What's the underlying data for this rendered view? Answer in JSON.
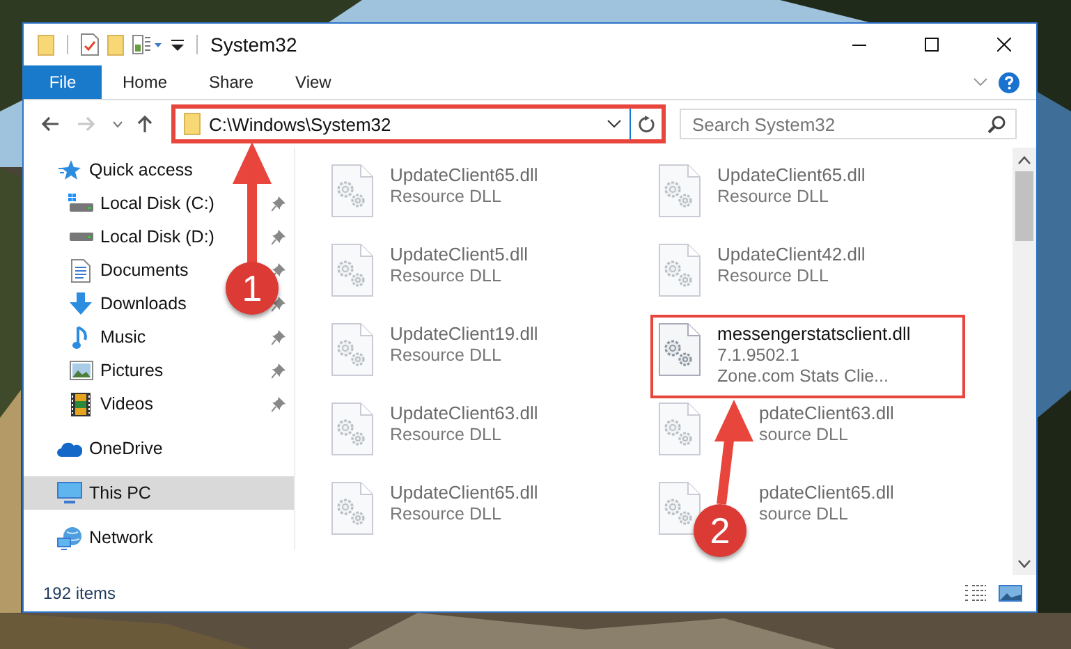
{
  "window": {
    "title": "System32"
  },
  "ribbon_tabs": [
    {
      "label": "File",
      "kind": "file"
    },
    {
      "label": "Home",
      "kind": "tab"
    },
    {
      "label": "Share",
      "kind": "tab"
    },
    {
      "label": "View",
      "kind": "tab"
    }
  ],
  "address_bar": {
    "path": "C:\\Windows\\System32",
    "highlighted": true
  },
  "search": {
    "placeholder": "Search System32"
  },
  "navigation": [
    {
      "label": "Quick access",
      "kind": "star",
      "selected": false,
      "children": [
        {
          "label": "Local Disk (C:)",
          "kind": "system-drive",
          "pinned": true,
          "selected": false
        },
        {
          "label": "Local Disk (D:)",
          "kind": "drive",
          "pinned": true,
          "selected": false
        },
        {
          "label": "Documents",
          "kind": "documents",
          "pinned": true,
          "selected": false
        },
        {
          "label": "Downloads",
          "kind": "downloads",
          "pinned": true,
          "selected": false
        },
        {
          "label": "Music",
          "kind": "music",
          "pinned": true,
          "selected": false
        },
        {
          "label": "Pictures",
          "kind": "pictures",
          "pinned": true,
          "selected": false
        },
        {
          "label": "Videos",
          "kind": "videos",
          "pinned": true,
          "selected": false
        }
      ]
    },
    {
      "label": "OneDrive",
      "kind": "cloud",
      "selected": false
    },
    {
      "label": "This PC",
      "kind": "pc",
      "selected": true
    },
    {
      "label": "Network",
      "kind": "network",
      "selected": false
    }
  ],
  "files": [
    {
      "name": "UpdateClient65.dll",
      "details": [
        "Resource DLL"
      ],
      "blurred": true,
      "highlighted": false,
      "partly_covered": false
    },
    {
      "name": "UpdateClient65.dll",
      "details": [
        "Resource DLL"
      ],
      "blurred": true,
      "highlighted": false,
      "partly_covered": false
    },
    {
      "name": "UpdateClient5.dll",
      "details": [
        "Resource DLL"
      ],
      "blurred": true,
      "highlighted": false,
      "partly_covered": false
    },
    {
      "name": "UpdateClient42.dll",
      "details": [
        "Resource DLL"
      ],
      "blurred": true,
      "highlighted": false,
      "partly_covered": false
    },
    {
      "name": "UpdateClient19.dll",
      "details": [
        "Resource DLL"
      ],
      "blurred": true,
      "highlighted": false,
      "partly_covered": false
    },
    {
      "name": "messengerstatsclient.dll",
      "details": [
        "7.1.9502.1",
        "Zone.com Stats Clie..."
      ],
      "blurred": false,
      "highlighted": true,
      "partly_covered": false
    },
    {
      "name": "UpdateClient63.dll",
      "details": [
        "Resource DLL"
      ],
      "blurred": true,
      "highlighted": false,
      "partly_covered": false
    },
    {
      "name": "pdateClient63.dll",
      "details": [
        "source DLL"
      ],
      "blurred": true,
      "highlighted": false,
      "partly_covered": true
    },
    {
      "name": "UpdateClient65.dll",
      "details": [
        "Resource DLL"
      ],
      "blurred": true,
      "highlighted": false,
      "partly_covered": false
    },
    {
      "name": "pdateClient65.dll",
      "details": [
        "source DLL"
      ],
      "blurred": true,
      "highlighted": false,
      "partly_covered": true
    }
  ],
  "status_bar": {
    "item_count": "192 items"
  },
  "callouts": [
    {
      "number": "1"
    },
    {
      "number": "2"
    }
  ]
}
